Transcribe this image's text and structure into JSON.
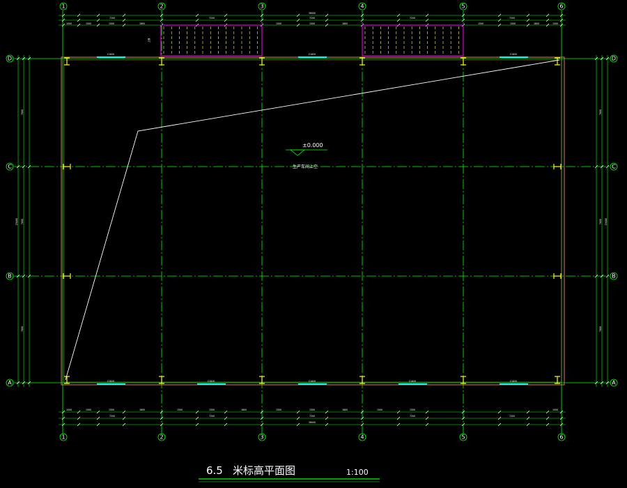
{
  "drawing": {
    "title_number": "6.5",
    "title_text": "米标高平面图",
    "scale": "1:100",
    "elevation_mark": "±0.000",
    "room_label": "生产车间上空",
    "stair_height_label": "上部"
  },
  "grid_axes": {
    "columns": [
      "1",
      "2",
      "3",
      "4",
      "5",
      "6"
    ],
    "rows": [
      "D",
      "C",
      "B",
      "A"
    ]
  },
  "dimensions": {
    "top_total": "36000",
    "top_spans": [
      "7200",
      "7200",
      "7200",
      "7200",
      "7200"
    ],
    "top_segments": [
      "1000",
      "1500",
      "1500",
      "1800",
      "1500",
      "1500",
      "1800",
      "1500",
      "1500",
      "1800",
      "1500",
      "1500",
      "1000"
    ],
    "bottom_segments": [
      "1000",
      "1500",
      "1500",
      "1800",
      "1500",
      "1500",
      "1800",
      "1500",
      "1500",
      "1800",
      "1500",
      "1500",
      "1000"
    ],
    "bottom_spans": [
      "7200",
      "7200",
      "7200",
      "7200",
      "7200"
    ],
    "bottom_total": "36000",
    "left_spans": [
      "7800",
      "7800",
      "7800"
    ],
    "left_total": "23400",
    "right_spans": [
      "7800",
      "7800",
      "7800"
    ],
    "right_total": "23400"
  },
  "windows": {
    "top_labels": [
      "C1820",
      "C1820",
      "C1820"
    ],
    "bottom_labels": [
      "C1820",
      "C1820",
      "C1820",
      "C1820",
      "C1820"
    ]
  },
  "colors": {
    "background": "#000000",
    "grid_line": "#00ff00",
    "wall": "#d0805a",
    "window": "#00ffff",
    "column": "#ffff00",
    "stair": "#ff00ff",
    "annotation": "#ffffff"
  }
}
